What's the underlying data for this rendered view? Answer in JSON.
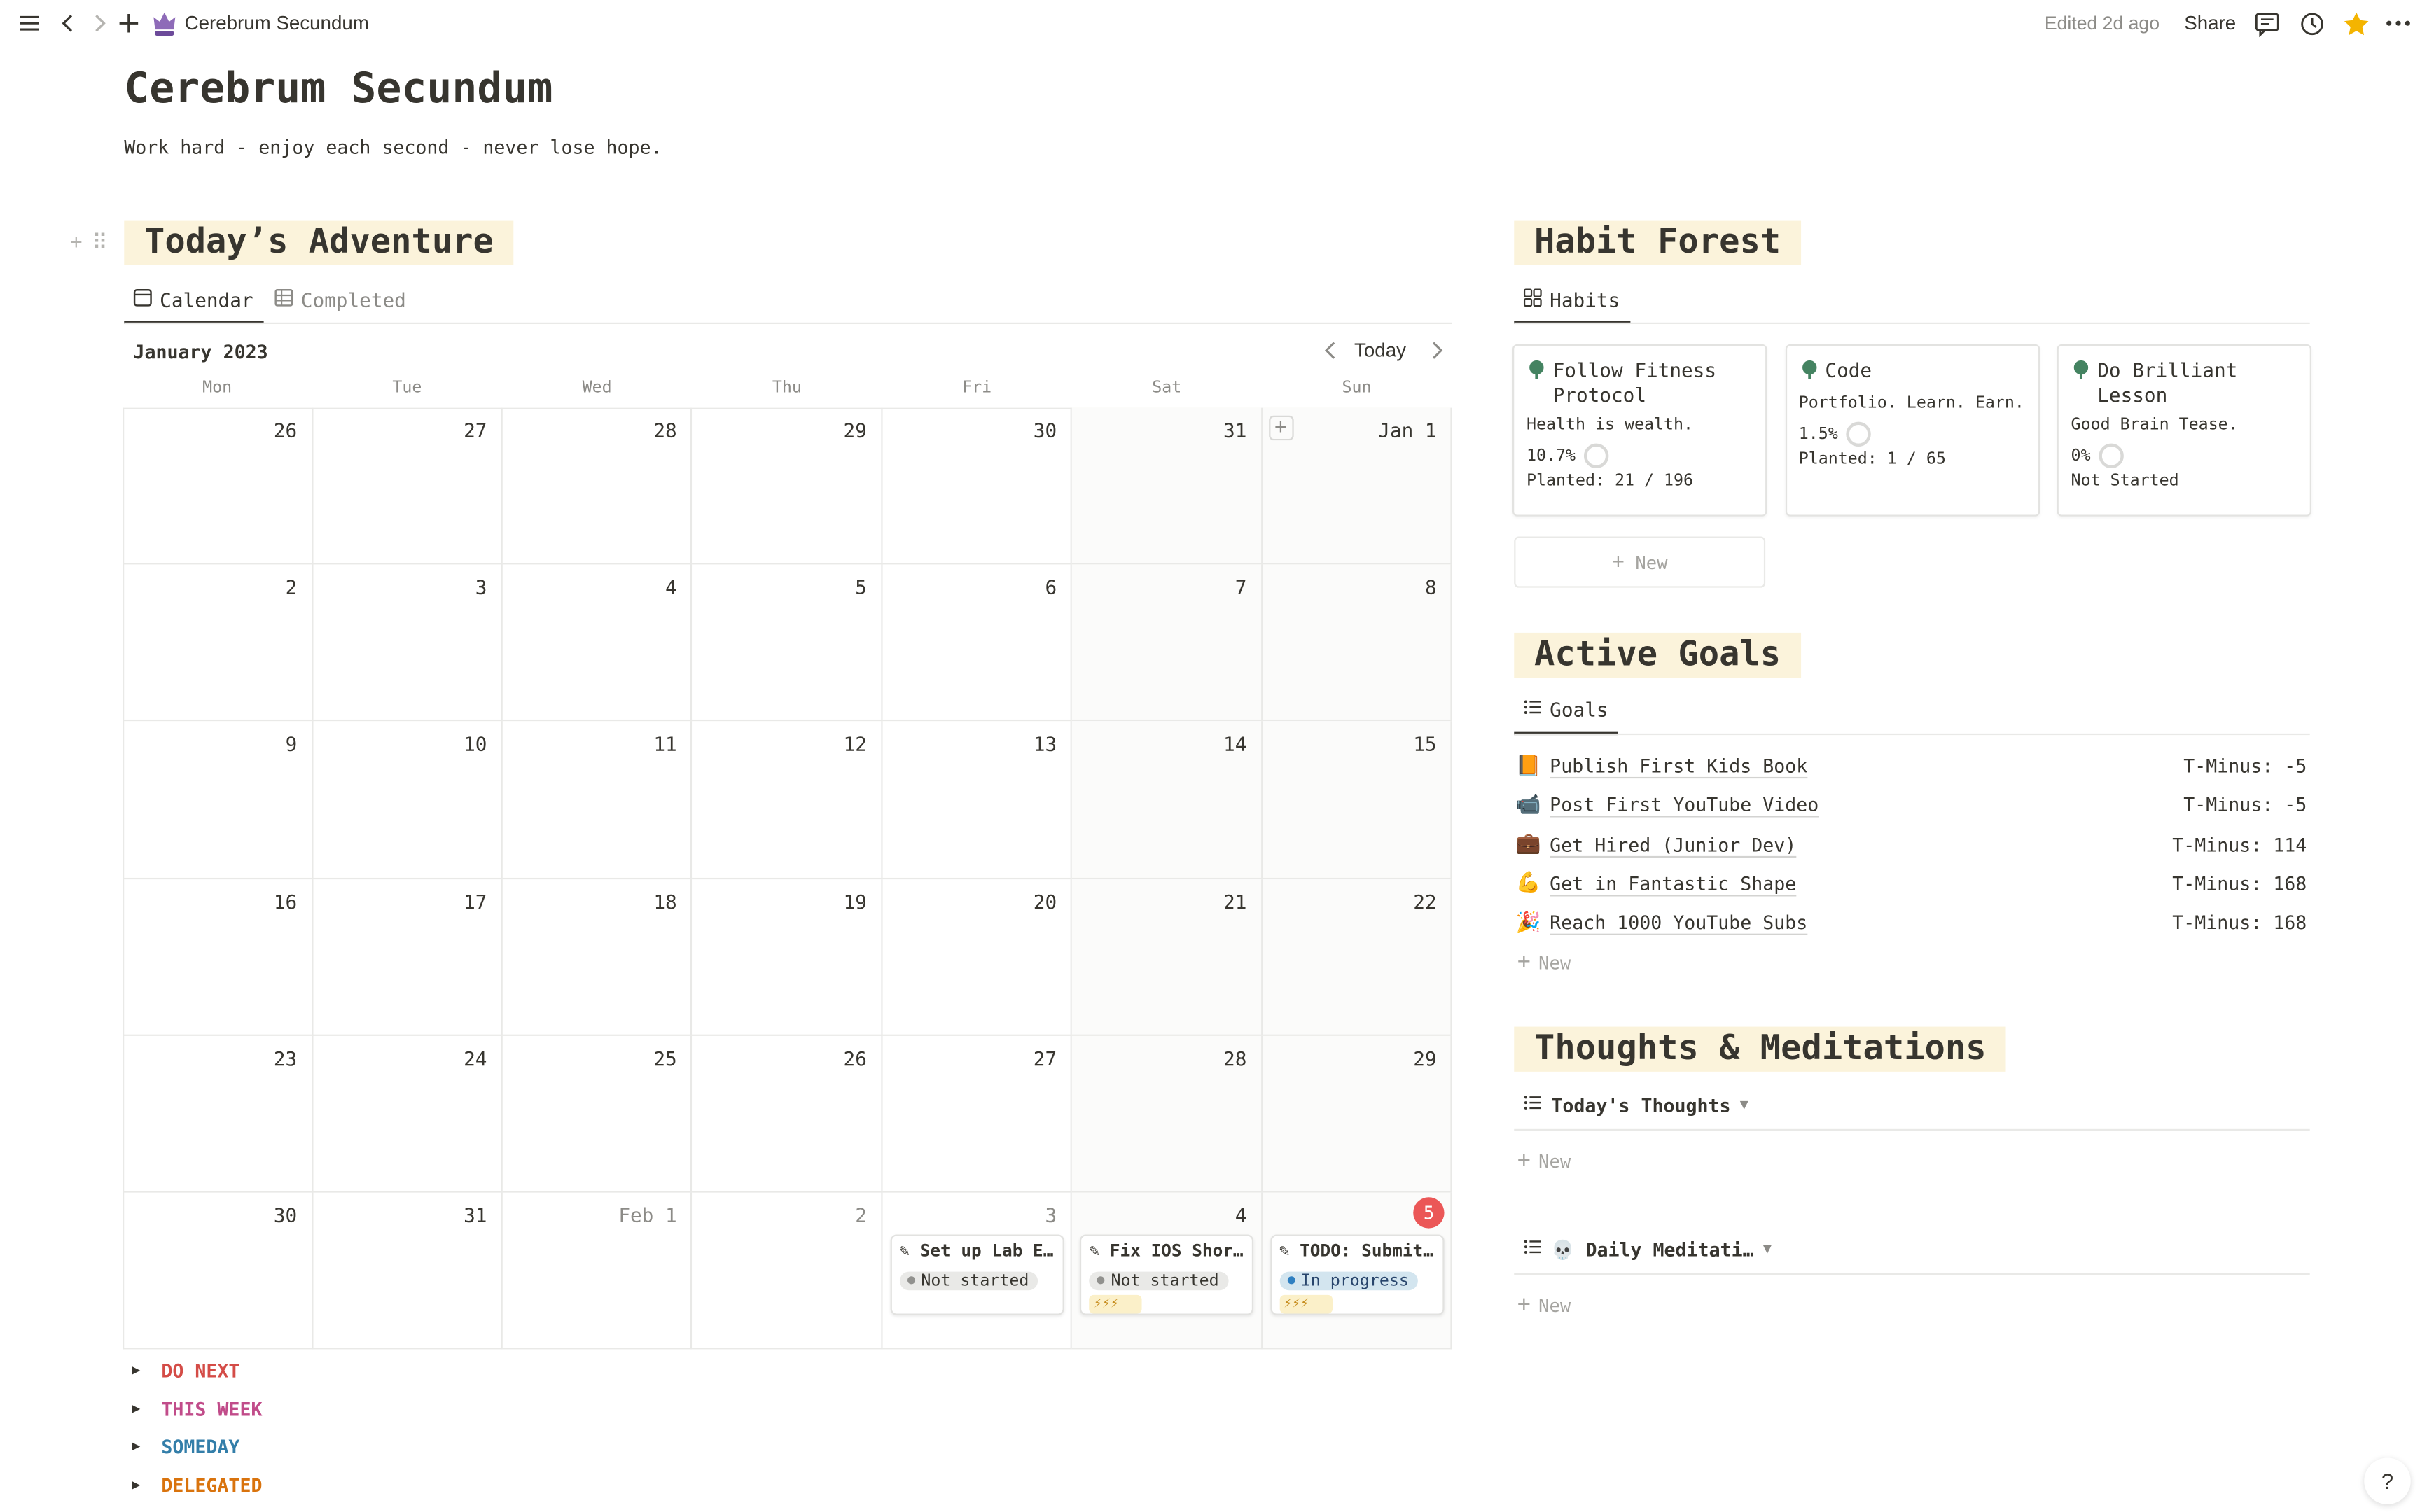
{
  "topbar": {
    "page_icon": "crown-icon",
    "title": "Cerebrum Secundum",
    "edited": "Edited 2d ago",
    "share": "Share"
  },
  "page": {
    "title": "Cerebrum Secundum",
    "subtitle": "Work hard - enjoy each second - never lose hope."
  },
  "adventure": {
    "heading": "Today’s Adventure",
    "tabs": [
      {
        "label": "Calendar",
        "icon": "calendar-icon",
        "active": true
      },
      {
        "label": "Completed",
        "icon": "table-icon",
        "active": false
      }
    ],
    "month": "January 2023",
    "today_label": "Today",
    "weekdays": [
      "Mon",
      "Tue",
      "Wed",
      "Thu",
      "Fri",
      "Sat",
      "Sun"
    ],
    "weeks": [
      [
        "26",
        "27",
        "28",
        "29",
        "30",
        "31",
        "Jan 1"
      ],
      [
        "2",
        "3",
        "4",
        "5",
        "6",
        "7",
        "8"
      ],
      [
        "9",
        "10",
        "11",
        "12",
        "13",
        "14",
        "15"
      ],
      [
        "16",
        "17",
        "18",
        "19",
        "20",
        "21",
        "22"
      ],
      [
        "23",
        "24",
        "25",
        "26",
        "27",
        "28",
        "29"
      ],
      [
        "30",
        "31",
        "Feb 1",
        "2",
        "3",
        "4",
        "5"
      ]
    ],
    "tasks": [
      {
        "title": "Set up Lab E…",
        "status": "Not started",
        "energy": ""
      },
      {
        "title": "Fix IOS Shor…",
        "status": "Not started",
        "energy": "⚡⚡⚡"
      },
      {
        "title": "TODO: Submit…",
        "status": "In progress",
        "energy": "⚡⚡⚡"
      }
    ],
    "toggles": [
      {
        "label": "DO NEXT",
        "color": "#d44c47"
      },
      {
        "label": "THIS WEEK",
        "color": "#c14c8a"
      },
      {
        "label": "SOMEDAY",
        "color": "#337ea9"
      },
      {
        "label": "DELEGATED",
        "color": "#d9730d"
      }
    ]
  },
  "habits": {
    "heading": "Habit Forest",
    "tab": "Habits",
    "cards": [
      {
        "icon": "tree-icon",
        "title": "Follow Fitness Protocol",
        "subtitle": "Health is wealth.",
        "percent": "10.7%",
        "status": "Planted: 21 / 196"
      },
      {
        "icon": "tree-icon",
        "title": "Code",
        "subtitle": "Portfolio. Learn. Earn.",
        "percent": "1.5%",
        "status": "Planted: 1 / 65"
      },
      {
        "icon": "tree-icon",
        "title": "Do Brilliant Lesson",
        "subtitle": "Good Brain Tease.",
        "percent": "0%",
        "status": "Not Started"
      }
    ],
    "new_label": "New"
  },
  "goals": {
    "heading": "Active Goals",
    "tab": "Goals",
    "items": [
      {
        "emoji": "📙",
        "name": "Publish First Kids Book",
        "tminus": "T-Minus: -5"
      },
      {
        "emoji": "📹",
        "name": "Post First YouTube Video",
        "tminus": "T-Minus: -5"
      },
      {
        "emoji": "💼",
        "name": "Get Hired (Junior Dev)",
        "tminus": "T-Minus: 114"
      },
      {
        "emoji": "💪",
        "name": "Get in Fantastic Shape",
        "tminus": "T-Minus: 168"
      },
      {
        "emoji": "🎉",
        "name": "Reach 1000 YouTube Subs",
        "tminus": "T-Minus: 168"
      }
    ],
    "new_label": "New"
  },
  "thoughts": {
    "heading": "Thoughts & Meditations",
    "view1": "Today's Thoughts",
    "view2": "💀 Daily Meditati…",
    "new_label": "New"
  },
  "help": "?",
  "colors": {
    "highlight": "#fbf3db",
    "today": "#eb5757",
    "tree": "#448361"
  }
}
